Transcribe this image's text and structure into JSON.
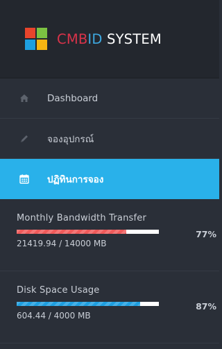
{
  "brand": {
    "letters": [
      {
        "text": "CMB",
        "color": "#d9334a"
      },
      {
        "text": "ID",
        "color": "#3ea8e0"
      },
      {
        "text": " SYSTEM",
        "color": "#ffffff"
      }
    ],
    "logo_colors": [
      "#e8452c",
      "#7cc242",
      "#1e9fe0",
      "#f7b512"
    ]
  },
  "menu": [
    {
      "label": "Dashboard",
      "icon": "home-icon",
      "active": false
    },
    {
      "label": "จองอุปกรณ์",
      "icon": "pencil-icon",
      "active": false
    },
    {
      "label": "ปฏิทินการจอง",
      "icon": "calendar-icon",
      "active": true
    }
  ],
  "stats": [
    {
      "title": "Monthly Bandwidth Transfer",
      "percent_text": "77%",
      "fill_fraction": 0.77,
      "values": "21419.94 / 14000 MB",
      "color": "#ef5a5a"
    },
    {
      "title": "Disk Space Usage",
      "percent_text": "87%",
      "fill_fraction": 0.87,
      "values": "604.44 / 4000 MB",
      "color": "#1e9fe0"
    }
  ],
  "colors": {
    "sidebar_bg": "#2a2f38",
    "header_bg": "#23272e",
    "active_bg": "#29b1ea",
    "text": "#c9ced6"
  }
}
